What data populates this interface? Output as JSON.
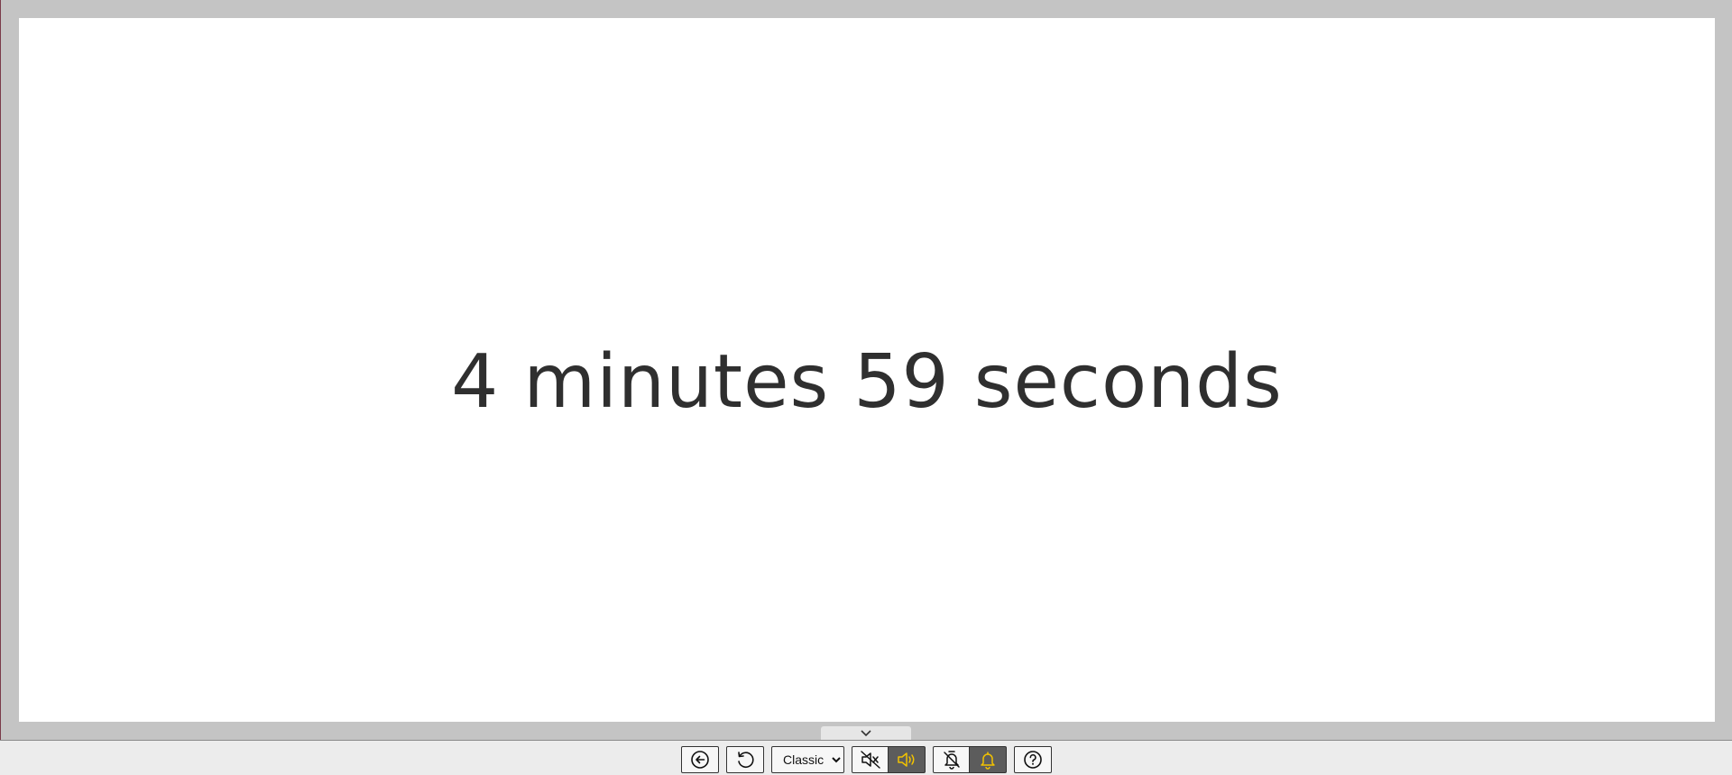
{
  "timer": {
    "display_text": "4 minutes 59 seconds"
  },
  "toolbar": {
    "style_select": {
      "selected": "Classic",
      "options": [
        "Classic"
      ]
    },
    "buttons": {
      "back": "back-arrow-icon",
      "reset": "reset-icon",
      "mute": "speaker-mute-icon",
      "sound_on": "speaker-on-icon",
      "bell_off": "bell-off-icon",
      "bell_on": "bell-on-icon",
      "help": "help-icon"
    },
    "states": {
      "sound_on_active": true,
      "bell_on_active": true
    }
  },
  "colors": {
    "timer_text": "#2f2f2f",
    "active_icon": "#f2c200",
    "active_bg": "#5c5c5c",
    "frame": "#c4c4c4",
    "display_bg": "#ffffff"
  }
}
